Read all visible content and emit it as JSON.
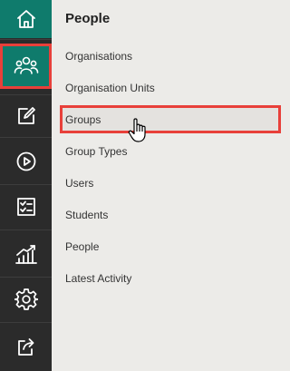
{
  "rail": {
    "items": [
      {
        "icon": "home-icon",
        "label": "Home"
      },
      {
        "icon": "people-icon",
        "label": "People",
        "active": true
      },
      {
        "icon": "edit-icon",
        "label": "Edit"
      },
      {
        "icon": "play-icon",
        "label": "Play"
      },
      {
        "icon": "checklist-icon",
        "label": "Checklist"
      },
      {
        "icon": "chart-icon",
        "label": "Reports"
      },
      {
        "icon": "gear-icon",
        "label": "Settings"
      },
      {
        "icon": "export-icon",
        "label": "Export"
      }
    ],
    "colors": {
      "background": "#2b2b2b",
      "accent": "#0f7b6c",
      "highlight": "#e8403a"
    }
  },
  "panel": {
    "title": "People",
    "items": [
      {
        "label": "Organisations"
      },
      {
        "label": "Organisation Units"
      },
      {
        "label": "Groups",
        "selected": true
      },
      {
        "label": "Group Types"
      },
      {
        "label": "Users"
      },
      {
        "label": "Students"
      },
      {
        "label": "People"
      },
      {
        "label": "Latest Activity"
      }
    ]
  }
}
